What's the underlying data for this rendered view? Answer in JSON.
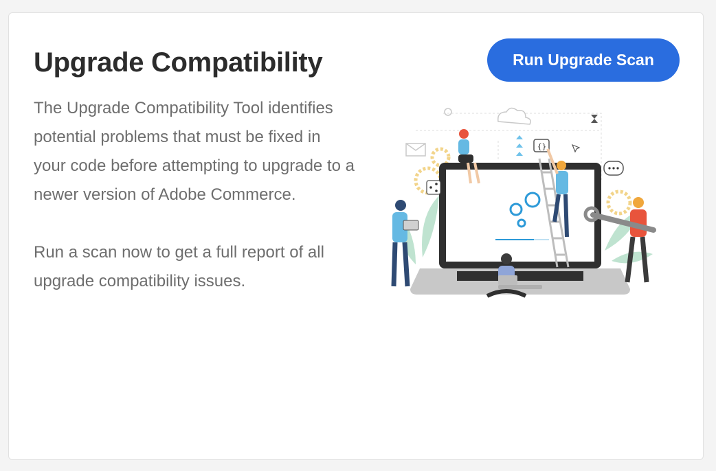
{
  "card": {
    "title": "Upgrade Compatibility",
    "button_label": "Run Upgrade Scan",
    "description": [
      "The Upgrade Compatibility Tool identifies potential problems that must be fixed in your code before attempting to upgrade to a newer version of Adobe Commerce.",
      "Run a scan now to get a full report of all upgrade compatibility issues."
    ],
    "illustration_icon": "laptop-team-illustration"
  },
  "colors": {
    "accent": "#2a6ddf",
    "title": "#2c2c2c",
    "text": "#6e6e6e",
    "gear": "#2d9ad8"
  }
}
